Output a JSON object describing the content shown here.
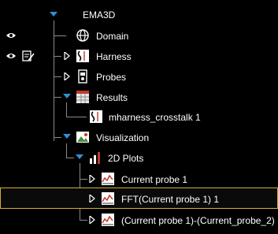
{
  "tree": {
    "root": {
      "label": "EMA3D",
      "icon": "collapse-arrow-icon"
    },
    "items": [
      {
        "id": "domain",
        "label": "Domain",
        "icon": "globe-icon"
      },
      {
        "id": "harness",
        "label": "Harness",
        "icon": "harness-icon",
        "expander": "expand-arrow-icon"
      },
      {
        "id": "probes",
        "label": "Probes",
        "icon": "probe-icon",
        "expander": "expand-arrow-icon"
      },
      {
        "id": "results",
        "label": "Results",
        "icon": "results-table-icon",
        "expander": "collapse-arrow-icon"
      },
      {
        "id": "results-child",
        "label": "mharness_crosstalk 1",
        "icon": "harness-icon"
      },
      {
        "id": "visualization",
        "label": "Visualization",
        "icon": "image-icon",
        "expander": "collapse-arrow-icon"
      },
      {
        "id": "plots2d",
        "label": "2D Plots",
        "icon": "bar-chart-icon",
        "expander": "collapse-arrow-icon"
      },
      {
        "id": "plot1",
        "label": "Current probe 1",
        "icon": "line-plot-icon",
        "expander": "expand-arrow-icon"
      },
      {
        "id": "plot2",
        "label": "FFT(Current probe 1) 1",
        "icon": "line-plot-icon",
        "expander": "expand-arrow-icon",
        "selected": true
      },
      {
        "id": "plot3",
        "label": "(Current probe 1)-(Current_probe_2)",
        "icon": "line-plot-icon",
        "expander": "expand-arrow-icon"
      }
    ],
    "row_toggles": [
      {
        "row": "domain",
        "icons": [
          "eye-icon"
        ]
      },
      {
        "row": "harness",
        "icons": [
          "eye-icon",
          "edit-icon"
        ]
      }
    ]
  },
  "colors": {
    "background": "#000000",
    "text": "#ffffff",
    "arrow": "#2f8fd8",
    "tree_line": "#8a8a8a",
    "selection_border": "#d4b02a"
  }
}
